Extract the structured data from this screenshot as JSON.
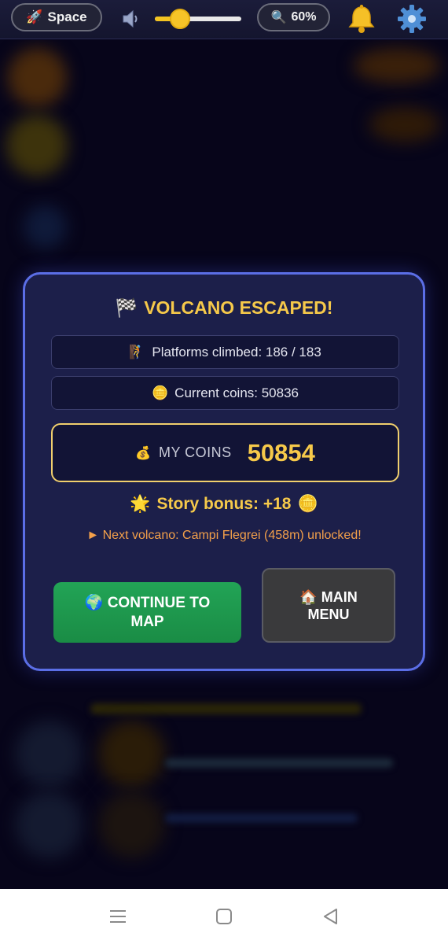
{
  "toolbar": {
    "mode_button": {
      "icon": "rocket-icon",
      "emoji": "🚀",
      "label": "Space"
    },
    "sound": {
      "icon": "speaker-icon",
      "volume_fraction": 0.29
    },
    "zoom": {
      "icon": "magnifier-icon",
      "emoji": "🔍",
      "label": "60%"
    },
    "notifications": {
      "icon": "bell-icon"
    },
    "settings": {
      "icon": "gear-icon"
    }
  },
  "dialog": {
    "title_emoji": "🏁",
    "title": "VOLCANO ESCAPED!",
    "platforms": {
      "emoji": "🧗",
      "text": "Platforms climbed: 186 / 183"
    },
    "current_coins": {
      "emoji": "🪙",
      "text": "Current coins: 50836"
    },
    "my_coins": {
      "emoji": "💰",
      "label": "MY COINS",
      "value": "50854"
    },
    "story_bonus": {
      "star_emoji": "🌟",
      "text": "Story bonus: +18",
      "coin_emoji": "🪙"
    },
    "next_volcano": "► Next volcano: Campi Flegrei (458m) unlocked!",
    "continue_button": {
      "emoji": "🌍",
      "label": "CONTINUE TO MAP"
    },
    "menu_button": {
      "emoji": "🏠",
      "label": "MAIN MENU"
    }
  },
  "colors": {
    "accent_gold": "#f6c94a",
    "dialog_border": "#5b6ee6",
    "continue_green": "#22a456",
    "next_orange": "#f3a04a"
  },
  "system_nav": {
    "icons": [
      "menu-icon",
      "home-icon",
      "back-icon"
    ]
  }
}
